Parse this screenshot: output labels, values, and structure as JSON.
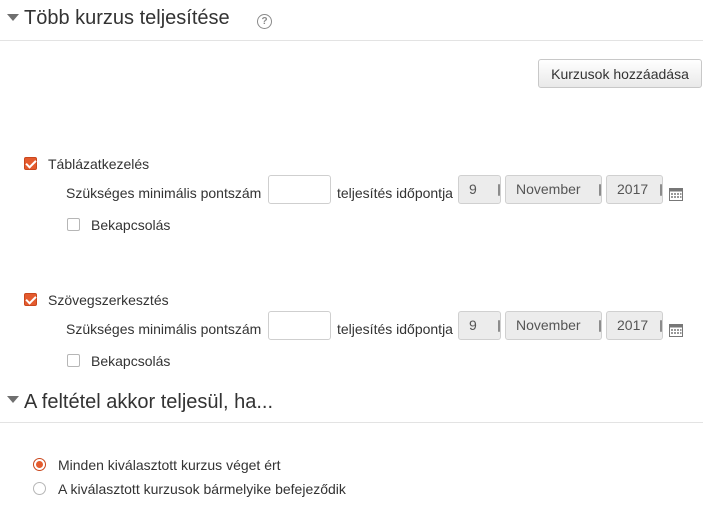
{
  "sections": {
    "multiple_courses": {
      "title": "Több kurzus teljesítése",
      "add_button": "Kurzusok hozzáadása"
    },
    "condition": {
      "title": "A feltétel akkor teljesül, ha..."
    }
  },
  "courses": [
    {
      "name": "Táblázatkezelés",
      "checked": true,
      "min_score_label": "Szükséges minimális pontszám",
      "min_score_value": "",
      "date_label": "teljesítés időpontja",
      "day": "9",
      "month": "November",
      "year": "2017",
      "enable_label": "Bekapcsolás",
      "enabled": false
    },
    {
      "name": "Szövegszerkesztés",
      "checked": true,
      "min_score_label": "Szükséges minimális pontszám",
      "min_score_value": "",
      "date_label": "teljesítés időpontja",
      "day": "9",
      "month": "November",
      "year": "2017",
      "enable_label": "Bekapcsolás",
      "enabled": false
    }
  ],
  "condition_options": [
    {
      "label": "Minden kiválasztott kurzus véget ért",
      "selected": true
    },
    {
      "label": "A kiválasztott kurzusok bármelyike befejeződik",
      "selected": false
    }
  ],
  "icons": {
    "help": "help-icon",
    "calendar": "calendar-icon",
    "collapse": "caret-down-icon"
  },
  "colors": {
    "accent": "#e45b2e",
    "text": "#333333",
    "divider": "#e3e3e3"
  }
}
